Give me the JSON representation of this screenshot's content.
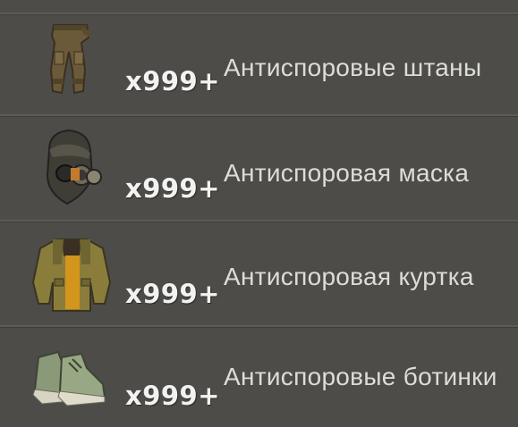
{
  "items": [
    {
      "icon": "anti-spore-pants-icon",
      "quantity": "x999+",
      "name": "Антиспоровые штаны"
    },
    {
      "icon": "anti-spore-mask-icon",
      "quantity": "x999+",
      "name": "Антиспоровая маска"
    },
    {
      "icon": "anti-spore-jacket-icon",
      "quantity": "x999+",
      "name": "Антиспоровая куртка"
    },
    {
      "icon": "anti-spore-boots-icon",
      "quantity": "x999+",
      "name": "Антиспоровые ботинки"
    }
  ],
  "colors": {
    "background": "#4d4c49",
    "divider": "#5c5b57",
    "quantity_text": "#f2f2f0",
    "name_text": "#dcdcd8"
  }
}
